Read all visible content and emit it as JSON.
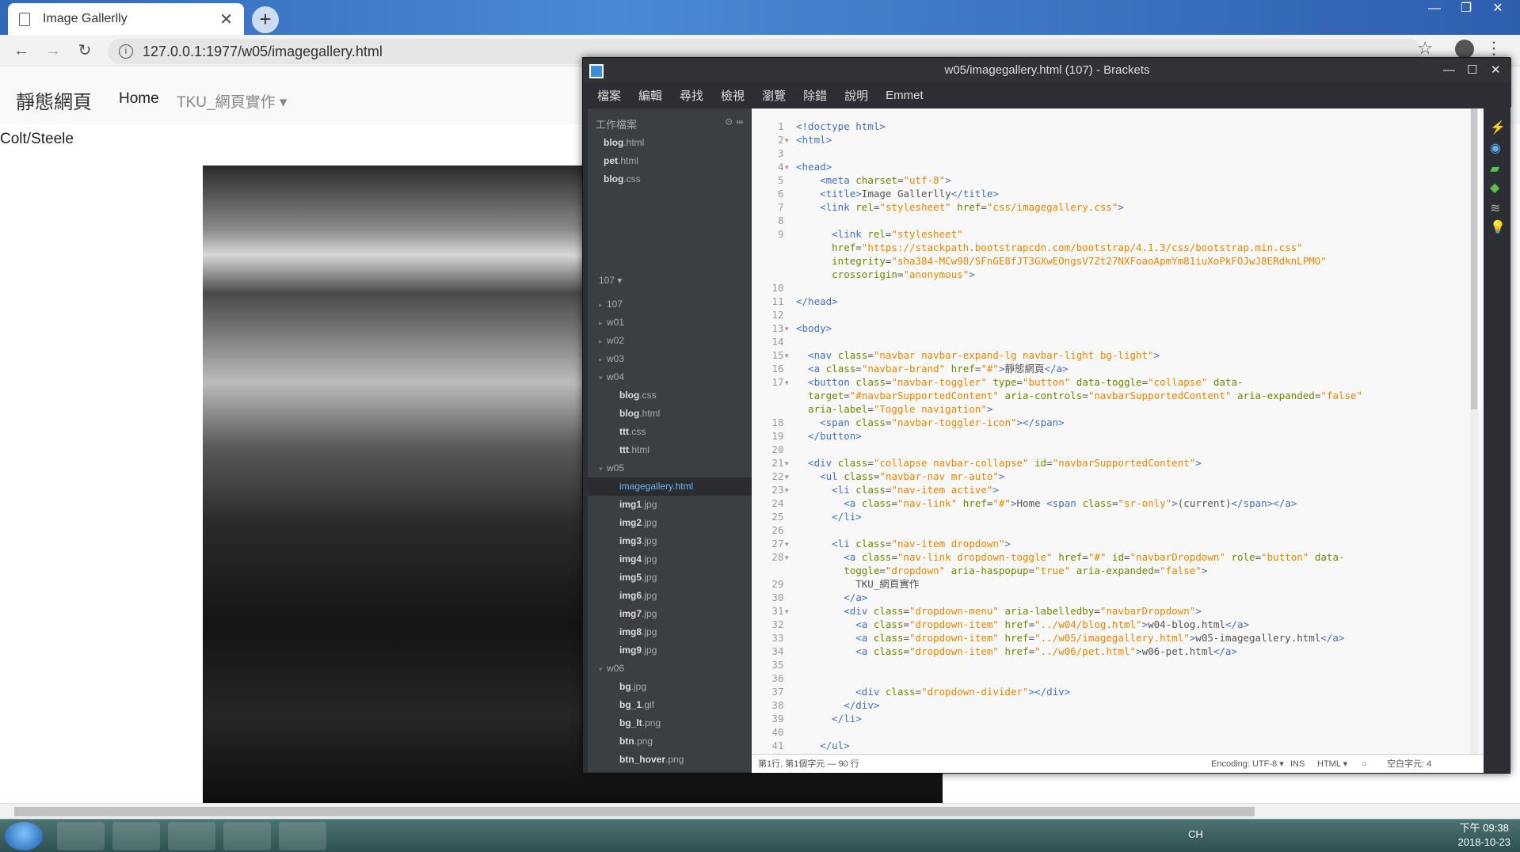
{
  "chrome": {
    "tab_title": "Image Gallerlly",
    "url": "127.0.0.1:1977/w05/imagegallery.html"
  },
  "page": {
    "brand": "靜態網頁",
    "nav_home": "Home",
    "nav_dropdown": "TKU_網頁實作",
    "caption": "Colt/Steele"
  },
  "brackets": {
    "title": "w05/imagegallery.html (107) - Brackets",
    "menu": [
      "檔案",
      "編輯",
      "尋找",
      "檢視",
      "瀏覽",
      "除錯",
      "說明",
      "Emmet"
    ],
    "working_files_header": "工作檔案",
    "working_files": [
      {
        "name": "blog",
        "ext": ".html"
      },
      {
        "name": "pet",
        "ext": ".html"
      },
      {
        "name": "blog",
        "ext": ".css"
      }
    ],
    "project": "107",
    "status": {
      "position": "第1行, 第1個字元 — 90 行",
      "encoding": "Encoding: UTF-8",
      "ins": "INS",
      "lang": "HTML",
      "spaces": "空白字元: 4"
    }
  },
  "taskbar": {
    "lang": "CH",
    "time": "下午 09:38",
    "date": "2018-10-23"
  }
}
